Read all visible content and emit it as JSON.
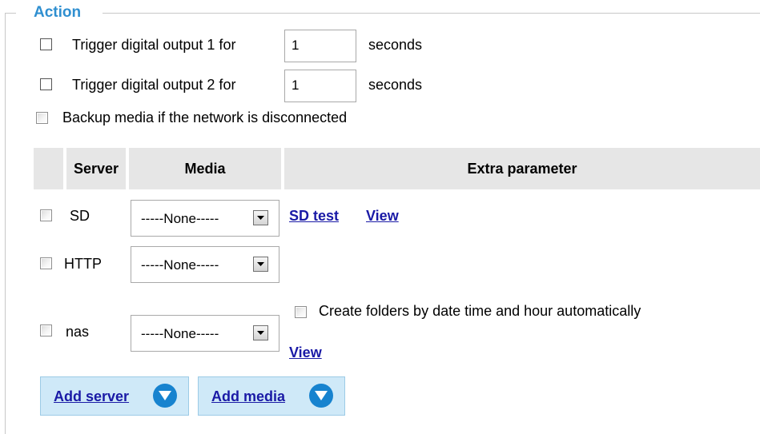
{
  "action": {
    "legend": "Action",
    "trigger1": {
      "label": "Trigger digital output 1 for",
      "value": "1",
      "unit": "seconds"
    },
    "trigger2": {
      "label": "Trigger digital output 2 for",
      "value": "1",
      "unit": "seconds"
    },
    "backup_label": "Backup media if the network is disconnected"
  },
  "table": {
    "headers": [
      "Server",
      "Media",
      "Extra parameter"
    ],
    "rows": [
      {
        "server": "SD",
        "media": "-----None-----",
        "links": [
          "SD test",
          "View"
        ]
      },
      {
        "server": "HTTP",
        "media": "-----None-----"
      },
      {
        "server": "nas",
        "media": "-----None-----",
        "folder_option": "Create folders by date time and hour automatically",
        "link": "View"
      }
    ]
  },
  "buttons": {
    "add_server": "Add server",
    "add_media": "Add media"
  },
  "colors": {
    "legend": "#2f8fd0",
    "link": "#1a1aa6",
    "button_bg": "#cfe9f8",
    "button_icon": "#1783cf",
    "header_bg": "#e6e6e6"
  }
}
